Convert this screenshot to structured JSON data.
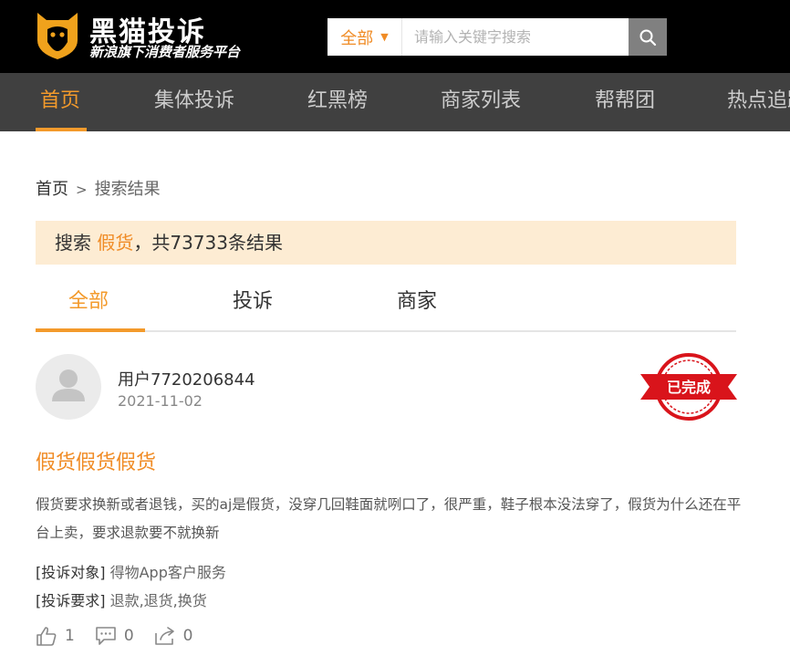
{
  "header": {
    "logo_title": "黑猫投诉",
    "logo_subtitle": "新浪旗下消费者服务平台",
    "search": {
      "category": "全部",
      "placeholder": "请输入关键字搜索",
      "value": ""
    }
  },
  "nav": {
    "items": [
      {
        "label": "首页",
        "active": true
      },
      {
        "label": "集体投诉"
      },
      {
        "label": "红黑榜"
      },
      {
        "label": "商家列表"
      },
      {
        "label": "帮帮团"
      },
      {
        "label": "热点追踪"
      }
    ]
  },
  "breadcrumb": {
    "home": "首页",
    "separator": ">",
    "current": "搜索结果"
  },
  "result_banner": {
    "prefix": "搜索 ",
    "keyword": "假货",
    "suffix": "，共73733条结果"
  },
  "tabs": [
    {
      "label": "全部",
      "active": true
    },
    {
      "label": "投诉"
    },
    {
      "label": "商家"
    }
  ],
  "complaint": {
    "user": "用户7720206844",
    "date": "2021-11-02",
    "status": "已完成",
    "title": "假货假货假货",
    "body": "假货要求换新或者退钱，买的aj是假货，没穿几回鞋面就咧口了，很严重，鞋子根本没法穿了，假货为什么还在平台上卖，要求退款要不就换新",
    "target_key": "[投诉对象]",
    "target_value": "得物App客户服务",
    "request_key": "[投诉要求]",
    "request_value": "退款,退货,换货",
    "likes": "1",
    "comments": "0",
    "shares": "0"
  },
  "colors": {
    "accent": "#f39a2b",
    "top_bar": "#000000",
    "nav_bar": "#404040",
    "banner_bg": "#fdecd3",
    "stamp_red": "#d9141b"
  },
  "icons": [
    "black-cat-logo-icon",
    "search-icon",
    "caret-down-icon",
    "default-avatar-icon",
    "completed-stamp-icon",
    "thumbs-up-icon",
    "comment-icon",
    "share-icon"
  ]
}
